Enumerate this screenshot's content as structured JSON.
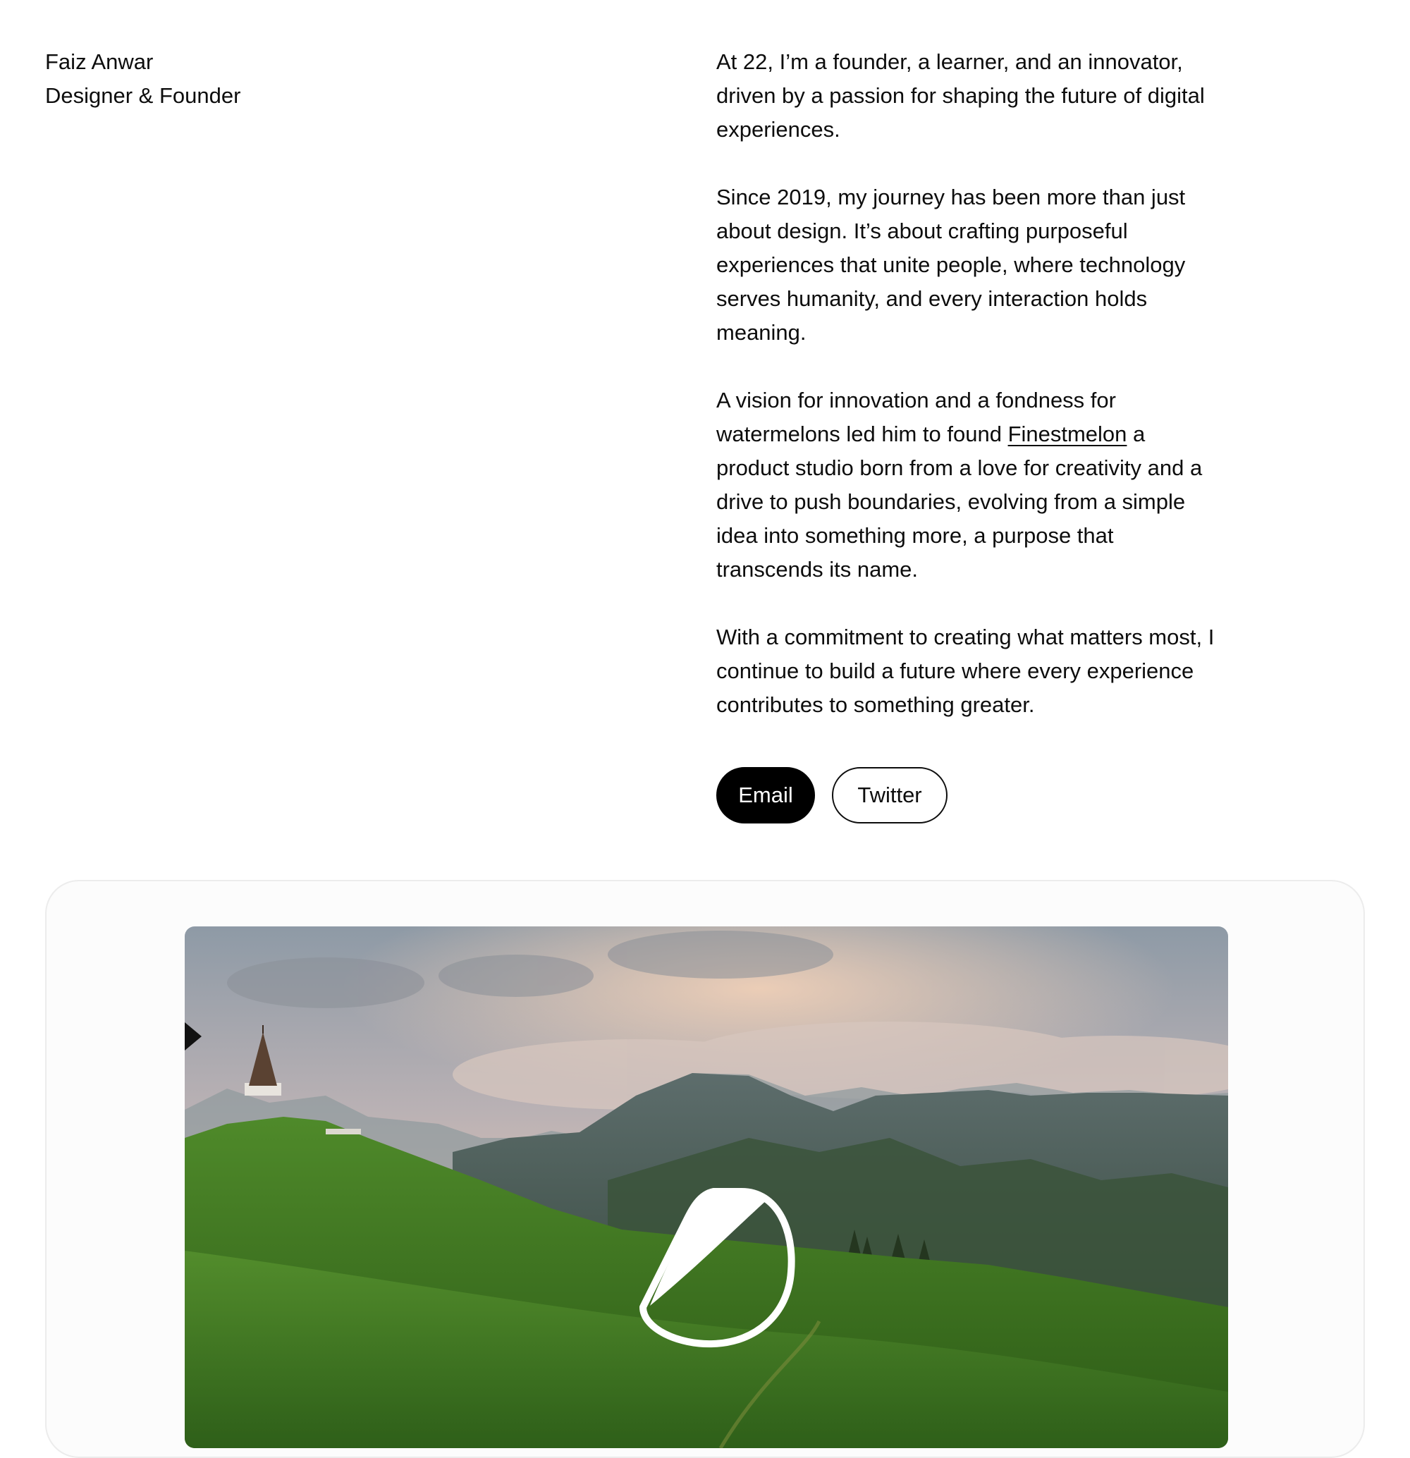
{
  "profile": {
    "name": "Faiz Anwar",
    "role": "Designer & Founder"
  },
  "bio": {
    "p1": "At 22, I’m a founder, a learner, and an innovator, driven by a passion for shaping the future of digital experiences.",
    "p2": "Since 2019, my journey has been more than just about design. It’s about crafting purposeful experiences that unite people, where technology serves humanity, and every interaction holds meaning.",
    "p3_before": "A vision for innovation and a fondness for watermelons led him to found ",
    "p3_link": "Finestmelon",
    "p3_after": " a product studio born from a love for creativity and a drive to push boundaries, evolving from a simple idea into something more, a purpose that transcends its name.",
    "p4": "With a commitment to creating what matters most, I continue to build a future where every experience contributes to something greater."
  },
  "actions": {
    "email_label": "Email",
    "twitter_label": "Twitter"
  },
  "media": {
    "scene": "mountain-meadow-with-chapel",
    "overlay_icon": "sticker-peel-icon"
  },
  "colors": {
    "text": "#0d0d0d",
    "primary_button_bg": "#000000",
    "primary_button_text": "#ffffff",
    "card_border": "#ececec"
  }
}
